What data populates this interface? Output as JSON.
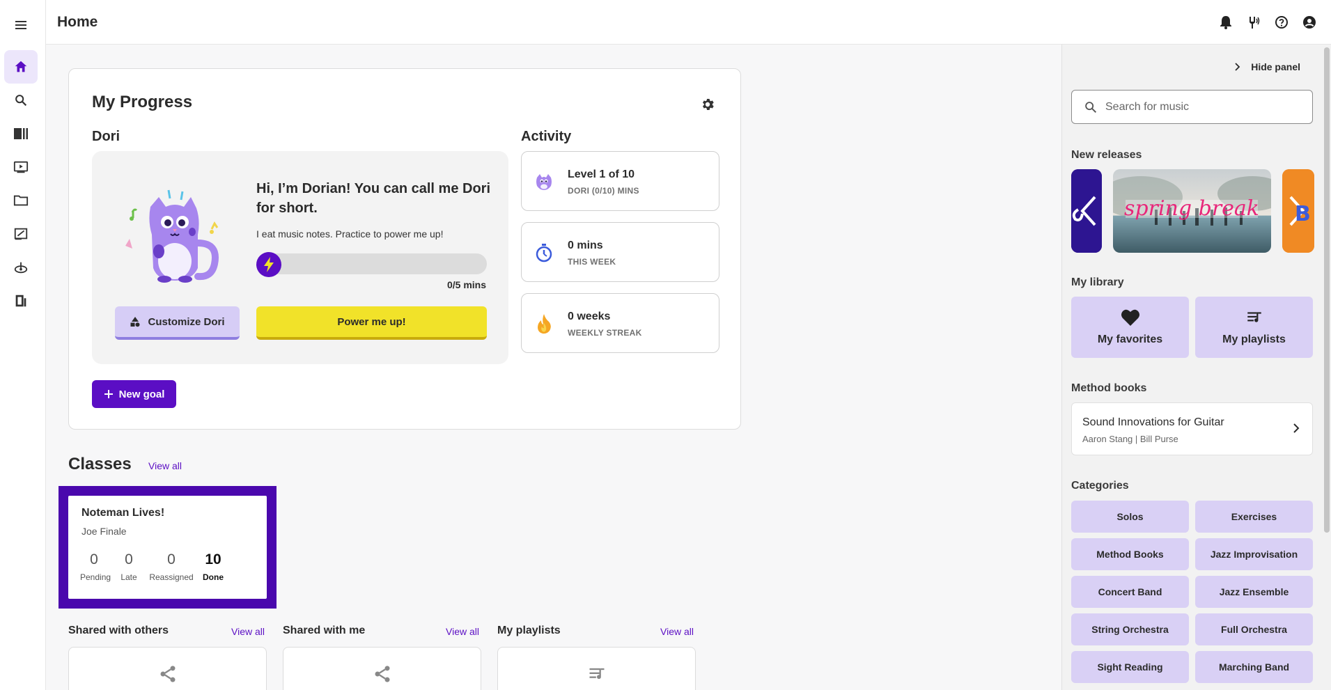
{
  "header": {
    "title": "Home"
  },
  "progress": {
    "title": "My Progress",
    "character_name": "Dori",
    "greeting": "Hi, I’m Dorian! You can call me Dori for short.",
    "subtext": "I eat music notes. Practice to power me up!",
    "mins_progress": "0/5 mins",
    "progress_fraction": 0.0,
    "customize_label": "Customize Dori",
    "power_label": "Power me up!",
    "new_goal_label": "New goal"
  },
  "activity": {
    "title": "Activity",
    "items": [
      {
        "value": "Level 1 of 10",
        "label": "DORI (0/10) MINS",
        "icon": "dori-icon"
      },
      {
        "value": "0 mins",
        "label": "THIS WEEK",
        "icon": "stopwatch-icon"
      },
      {
        "value": "0 weeks",
        "label": "WEEKLY STREAK",
        "icon": "flame-icon"
      }
    ]
  },
  "classes": {
    "title": "Classes",
    "view_all": "View all",
    "cards": [
      {
        "name": "Noteman Lives!",
        "teacher": "Joe Finale",
        "stats": [
          {
            "n": "0",
            "t": "Pending"
          },
          {
            "n": "0",
            "t": "Late"
          },
          {
            "n": "0",
            "t": "Reassigned"
          },
          {
            "n": "10",
            "t": "Done"
          }
        ]
      }
    ]
  },
  "sections": [
    {
      "title": "Shared with others",
      "view_all": "View all",
      "icon": "share-icon"
    },
    {
      "title": "Shared with me",
      "view_all": "View all",
      "icon": "share-icon"
    },
    {
      "title": "My playlists",
      "view_all": "View all",
      "icon": "playlist-icon"
    }
  ],
  "panel": {
    "hide_label": "Hide panel",
    "search_placeholder": "Search for music",
    "new_releases_title": "New releases",
    "release_banner_text": "spring break",
    "my_library_title": "My library",
    "library": [
      {
        "label": "My favorites",
        "icon": "heart-icon"
      },
      {
        "label": "My playlists",
        "icon": "playlist-icon"
      }
    ],
    "method_books_title": "Method books",
    "method_book": {
      "title": "Sound Innovations for Guitar",
      "authors": "Aaron Stang | Bill Purse"
    },
    "categories_title": "Categories",
    "categories": [
      "Solos",
      "Exercises",
      "Method Books",
      "Jazz Improvisation",
      "Concert Band",
      "Jazz Ensemble",
      "String Orchestra",
      "Full Orchestra",
      "Sight Reading",
      "Marching Band"
    ]
  },
  "colors": {
    "accent": "#5b0ec4",
    "power_yellow": "#f1e229",
    "lavender": "#d9d0f5"
  }
}
